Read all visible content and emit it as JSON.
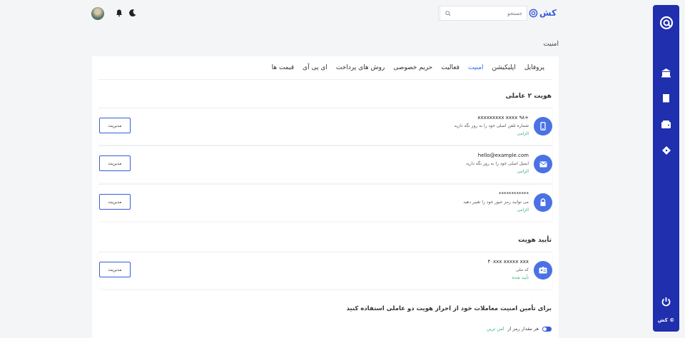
{
  "brand": {
    "name": "کش"
  },
  "search": {
    "placeholder": "جستجو"
  },
  "page": {
    "title": "امنیت"
  },
  "tabs": [
    {
      "label": "پروفایل",
      "active": false
    },
    {
      "label": "اپلیکیشن",
      "active": false
    },
    {
      "label": "امنیت",
      "active": true
    },
    {
      "label": "فعالیت",
      "active": false
    },
    {
      "label": "حریم خصوصی",
      "active": false
    },
    {
      "label": "روش های پرداخت",
      "active": false
    },
    {
      "label": "ای پی آی",
      "active": false
    },
    {
      "label": "قیمت ها",
      "active": false
    }
  ],
  "two_factor": {
    "title": "هویت ۲ عاملی",
    "items": [
      {
        "icon": "phone-icon",
        "value": "+۹۸ xxxxxxxxx xxxx",
        "description": "شماره تلفن اصلی خود را به روز نگه دارید",
        "status": "الزامی",
        "button": "مدیریت"
      },
      {
        "icon": "mail-icon",
        "value": "hello@example.com",
        "description": "ایمیل اصلی خود را به روز نگه دارید",
        "status": "الزامی",
        "button": "مدیریت"
      },
      {
        "icon": "lock-icon",
        "value": "************",
        "description": "می توانید رمز عبور خود را تغییر دهید",
        "status": "الزامی",
        "button": "مدیریت"
      }
    ]
  },
  "identity": {
    "title": "تأیید هویت",
    "items": [
      {
        "icon": "id-card-icon",
        "value": "۴۰xxx xxxxx xxx",
        "description": "کد ملی",
        "status": "تأیید شده",
        "button": "مدیریت"
      }
    ]
  },
  "note": {
    "text": "برای تأمین امنیت معاملات خود از احراز هویت دو عاملی استفاده کنید"
  },
  "toggle": {
    "label": "هر مقدار رمز از",
    "strength": "امن ترین"
  },
  "footer": {
    "copyright": "© کش"
  },
  "colors": {
    "primary": "#1f2fae",
    "accent": "#3a5bd9",
    "success": "#2bb673"
  }
}
